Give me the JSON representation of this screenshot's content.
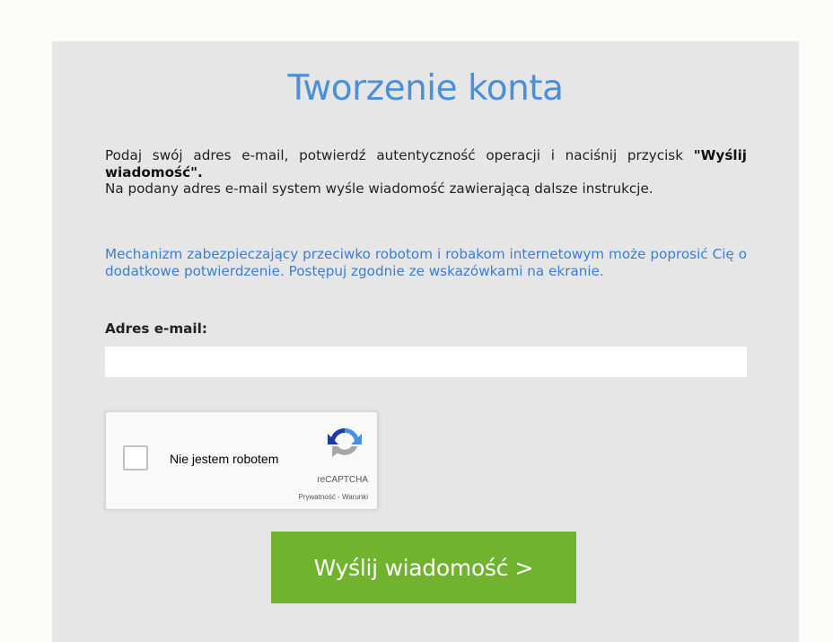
{
  "page": {
    "title": "Tworzenie konta"
  },
  "intro": {
    "text_before": "Podaj swój adres e-mail, potwierdź autentyczność operacji i naciśnij przycisk ",
    "button_ref": "\"Wyślij wiadomość\".",
    "text_after": "Na podany adres e-mail system wyśle wiadomość zawierającą dalsze instrukcje."
  },
  "notice": {
    "text": "Mechanizm zabezpieczający przeciwko robotom i robakom internetowym może poprosić Cię o dodatkowe potwierdzenie. Postępuj zgodnie ze wskazówkami na ekranie."
  },
  "form": {
    "email_label": "Adres e-mail:",
    "email_value": "",
    "email_placeholder": ""
  },
  "captcha": {
    "label": "Nie jestem robotem",
    "brand": "reCAPTCHA",
    "privacy_link": "Prywatność",
    "separator": " - ",
    "terms_link": "Warunki",
    "icon": "recaptcha-logo-icon"
  },
  "actions": {
    "send_label": "Wyślij wiadomość >"
  },
  "colors": {
    "accent_blue": "#4a90d9",
    "notice_blue": "#3a7fd0",
    "button_green": "#6fb32e",
    "panel_gray": "#e6e6e6"
  }
}
